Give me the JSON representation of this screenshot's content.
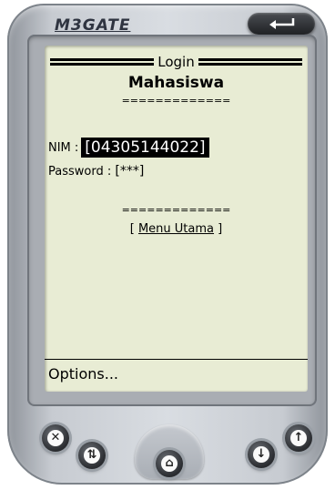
{
  "device": {
    "brand": "M3GATE"
  },
  "screen": {
    "title": "Login",
    "subtitle": "Mahasiswa",
    "separator": "=============",
    "nim_label": "NIM :",
    "nim_value": "[04305144022]",
    "password_label": "Password :",
    "password_value": "[***]",
    "menu_link": {
      "open": "[",
      "label": "Menu Utama",
      "close": "]"
    },
    "softkey": "Options..."
  },
  "colors": {
    "screen_bg": "#e8ecd4",
    "body": "#c7cbd1",
    "button": "#2a2c30"
  }
}
